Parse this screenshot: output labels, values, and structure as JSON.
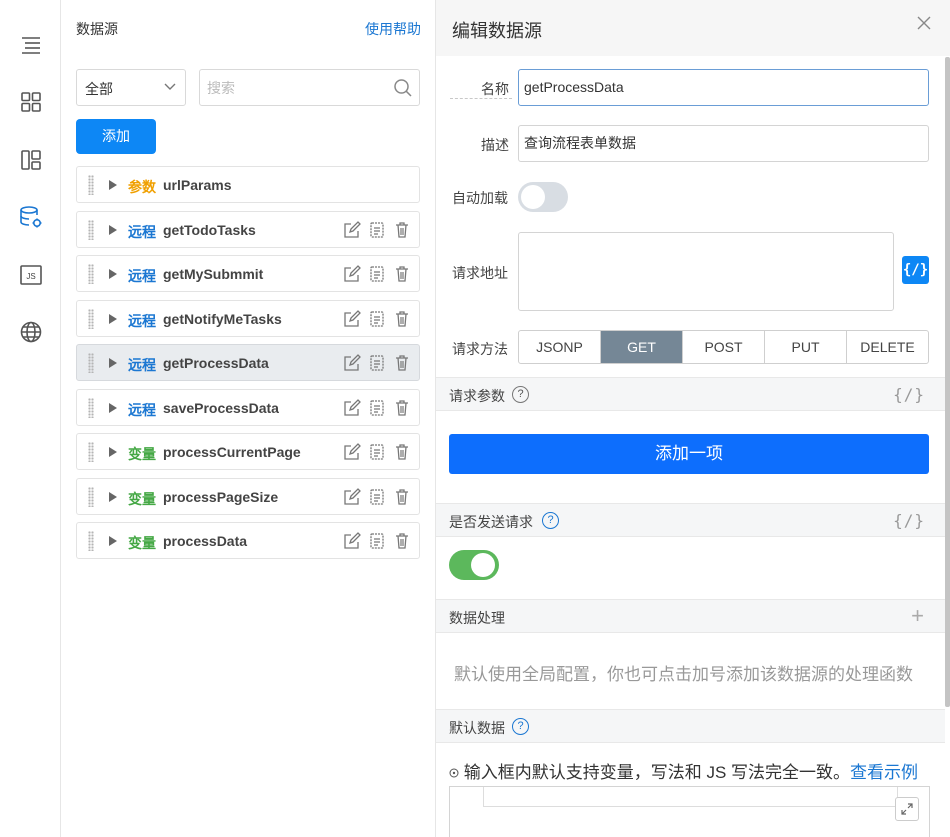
{
  "sidebar": {
    "icons": [
      "outline-icon",
      "components-icon",
      "layout-icon",
      "datasource-icon",
      "js-icon",
      "globe-icon"
    ],
    "js_label": "JS",
    "active_color": "#1b77d2"
  },
  "datasource_panel": {
    "title": "数据源",
    "help_link": "使用帮助",
    "filter_value": "全部",
    "search_placeholder": "搜索",
    "add_button": "添加",
    "items": [
      {
        "type": "参数",
        "kind": "param",
        "name": "urlParams",
        "actions": false,
        "active": false
      },
      {
        "type": "远程",
        "kind": "remote",
        "name": "getTodoTasks",
        "actions": true,
        "active": false
      },
      {
        "type": "远程",
        "kind": "remote",
        "name": "getMySubmmit",
        "actions": true,
        "active": false
      },
      {
        "type": "远程",
        "kind": "remote",
        "name": "getNotifyMeTasks",
        "actions": true,
        "active": false
      },
      {
        "type": "远程",
        "kind": "remote",
        "name": "getProcessData",
        "actions": true,
        "active": true
      },
      {
        "type": "远程",
        "kind": "remote",
        "name": "saveProcessData",
        "actions": true,
        "active": false
      },
      {
        "type": "变量",
        "kind": "var",
        "name": "processCurrentPage",
        "actions": true,
        "active": false
      },
      {
        "type": "变量",
        "kind": "var",
        "name": "processPageSize",
        "actions": true,
        "active": false
      },
      {
        "type": "变量",
        "kind": "var",
        "name": "processData",
        "actions": true,
        "active": false
      }
    ]
  },
  "edit_panel": {
    "title": "编辑数据源",
    "name_label": "名称",
    "name_value": "getProcessData",
    "desc_label": "描述",
    "desc_value": "查询流程表单数据",
    "autoload_label": "自动加载",
    "autoload_on": false,
    "url_label": "请求地址",
    "url_value": "",
    "fx_label": "{/}",
    "method_label": "请求方法",
    "methods": [
      "JSONP",
      "GET",
      "POST",
      "PUT",
      "DELETE"
    ],
    "selected_method": "GET",
    "params_section": "请求参数",
    "add_item_button": "添加一项",
    "send_section": "是否发送请求",
    "send_on": true,
    "processing_section": "数据处理",
    "processing_hint": "默认使用全局配置，你也可点击加号添加该数据源的处理函数",
    "default_data_section": "默认数据",
    "default_data_note": "输入框内默认支持变量，写法和 JS 写法完全一致。",
    "example_link": "查看示例",
    "help_symbol": "?",
    "plus_symbol": "+"
  },
  "colors": {
    "primary": "#0d87f5",
    "param": "#f0a000",
    "remote": "#1b77d2",
    "var": "#45a845",
    "toggle_on": "#5cb85c"
  }
}
